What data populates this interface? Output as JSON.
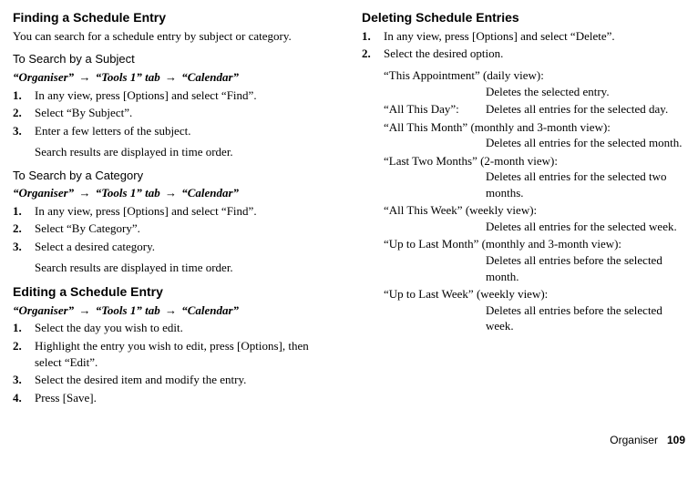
{
  "left": {
    "section1": {
      "title": "Finding a Schedule Entry",
      "intro": "You can search for a schedule entry by subject or category.",
      "subA": {
        "heading": "To Search by a Subject",
        "nav1": "“Organiser”",
        "nav2": "“Tools 1” tab",
        "nav3": "“Calendar”",
        "steps": [
          "In any view, press [Options] and select “Find”.",
          "Select “By Subject”.",
          "Enter a few letters of the subject."
        ],
        "note": "Search results are displayed in time order."
      },
      "subB": {
        "heading": "To Search by a Category",
        "nav1": "“Organiser”",
        "nav2": "“Tools 1” tab",
        "nav3": "“Calendar”",
        "steps": [
          "In any view, press [Options] and select “Find”.",
          "Select “By Category”.",
          "Select a desired category."
        ],
        "note": "Search results are displayed in time order."
      }
    },
    "section2": {
      "title": "Editing a Schedule Entry",
      "nav1": "“Organiser”",
      "nav2": "“Tools 1” tab",
      "nav3": "“Calendar”",
      "steps": [
        "Select the day you wish to edit.",
        "Highlight the entry you wish to edit, press [Options], then select “Edit”.",
        "Select the desired item and modify the entry.",
        "Press [Save]."
      ]
    }
  },
  "right": {
    "section": {
      "title": "Deleting Schedule Entries",
      "steps": [
        "In any view, press [Options] and select “Delete”.",
        "Select the desired option."
      ],
      "options": [
        {
          "term": "“This Appointment” (daily view):",
          "desc": "Deletes the selected entry.",
          "stack": true
        },
        {
          "term": "“All This Day”:",
          "desc": "Deletes all entries for the selected day.",
          "stack": false
        },
        {
          "term": "“All This Month” (monthly and 3-month view):",
          "desc": "Deletes all entries for the selected month.",
          "stack": true
        },
        {
          "term": "“Last Two Months” (2-month view):",
          "desc": "Deletes all entries for the selected two months.",
          "stack": true
        },
        {
          "term": "“All This Week” (weekly view):",
          "desc": "Deletes all entries for the selected week.",
          "stack": true
        },
        {
          "term": "“Up to Last Month” (monthly and 3-month view):",
          "desc": "Deletes all entries before the selected month.",
          "stack": true
        },
        {
          "term": "“Up to Last Week” (weekly view):",
          "desc": "Deletes all entries before the selected week.",
          "stack": true
        }
      ]
    }
  },
  "footer": {
    "section": "Organiser",
    "page": "109"
  },
  "arrow": "→"
}
